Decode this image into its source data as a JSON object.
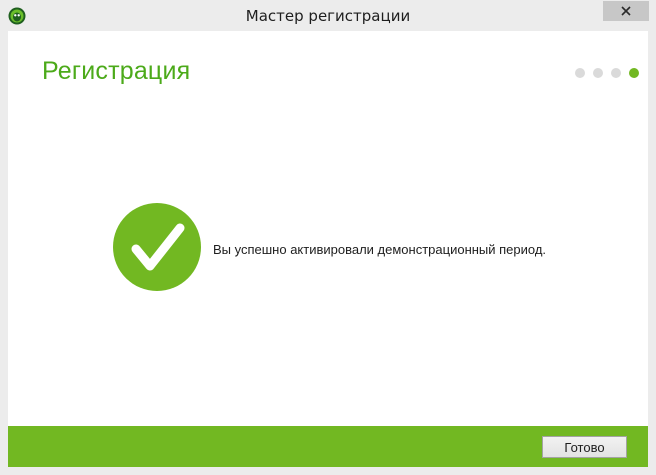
{
  "window": {
    "title": "Мастер регистрации",
    "app_icon": "beetle-logo-icon",
    "close_icon": "close-icon"
  },
  "page": {
    "heading": "Регистрация",
    "step_indicator": {
      "total": 4,
      "current": 4
    },
    "status_icon": "checkmark-circle-icon",
    "message": "Вы успешно активировали демонстрационный период."
  },
  "footer": {
    "done_label": "Готово"
  },
  "colors": {
    "accent": "#72b822",
    "heading": "#4caa1a",
    "inactive_dot": "#dadada"
  }
}
